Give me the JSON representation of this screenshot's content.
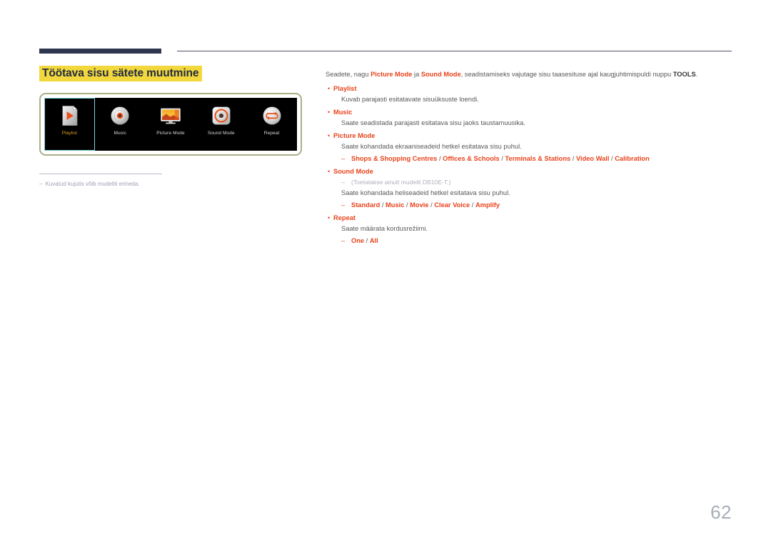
{
  "document": {
    "page_number": "62"
  },
  "title": {
    "text": "Töötava sisu sätete muutmine",
    "highlight_color": "#f2d83c",
    "text_color": "#222a42"
  },
  "device_panel": {
    "border_color": "#a8b187",
    "screen_background": "#000000",
    "selected_index": 0,
    "tiles": [
      {
        "label": "Playlist",
        "icon": "playlist-file-play-icon",
        "selected": true
      },
      {
        "label": "Music",
        "icon": "music-disc-icon",
        "selected": false
      },
      {
        "label": "Picture Mode",
        "icon": "picture-monitor-icon",
        "selected": false
      },
      {
        "label": "Sound Mode",
        "icon": "sound-speaker-icon",
        "selected": false
      },
      {
        "label": "Repeat",
        "icon": "repeat-loop-icon",
        "selected": false
      }
    ]
  },
  "image_footnote": {
    "dash": "‒",
    "text": "Kuvatud kujutis võib mudeliti erineda."
  },
  "content": {
    "intro": {
      "part1": "Seadete, nagu ",
      "bold1": "Picture Mode",
      "part2": " ja ",
      "bold2": "Sound Mode",
      "part3": ", seadistamiseks vajutage sisu taasesituse ajal kaugjuhtimispuldi nuppu ",
      "bold3": "TOOLS",
      "part4": "."
    },
    "bullets": [
      {
        "dot": "•",
        "heading": "Playlist",
        "description": "Kuvab parajasti esitatavate sisuüksuste loendi."
      },
      {
        "dot": "•",
        "heading": "Music",
        "description": "Saate seadistada parajasti esitatava sisu jaoks taustamuusika."
      },
      {
        "dot": "•",
        "heading": "Picture Mode",
        "description": "Saate kohandada ekraaniseadeid hetkel esitatava sisu puhul.",
        "options_dash": "‒",
        "options": "Shops & Shopping Centres / Offices & Schools / Terminals & Stations / Video Wall / Calibration"
      },
      {
        "dot": "•",
        "heading": "Sound Mode",
        "note_dash": "‒",
        "note": "(Toetatakse ainult mudelit DB10E-T.)",
        "description": "Saate kohandada heliseadeid hetkel esitatava sisu puhul.",
        "options_dash": "‒",
        "options": "Standard / Music / Movie / Clear Voice / Amplify"
      },
      {
        "dot": "•",
        "heading": "Repeat",
        "description": "Saate määrata kordusrežiimi.",
        "options_dash": "‒",
        "options": "One / All"
      }
    ]
  },
  "colors": {
    "accent_orange": "#e8431c",
    "rule_navy": "#2e3650",
    "body_text": "#58595b",
    "muted": "#b0b2ba"
  }
}
